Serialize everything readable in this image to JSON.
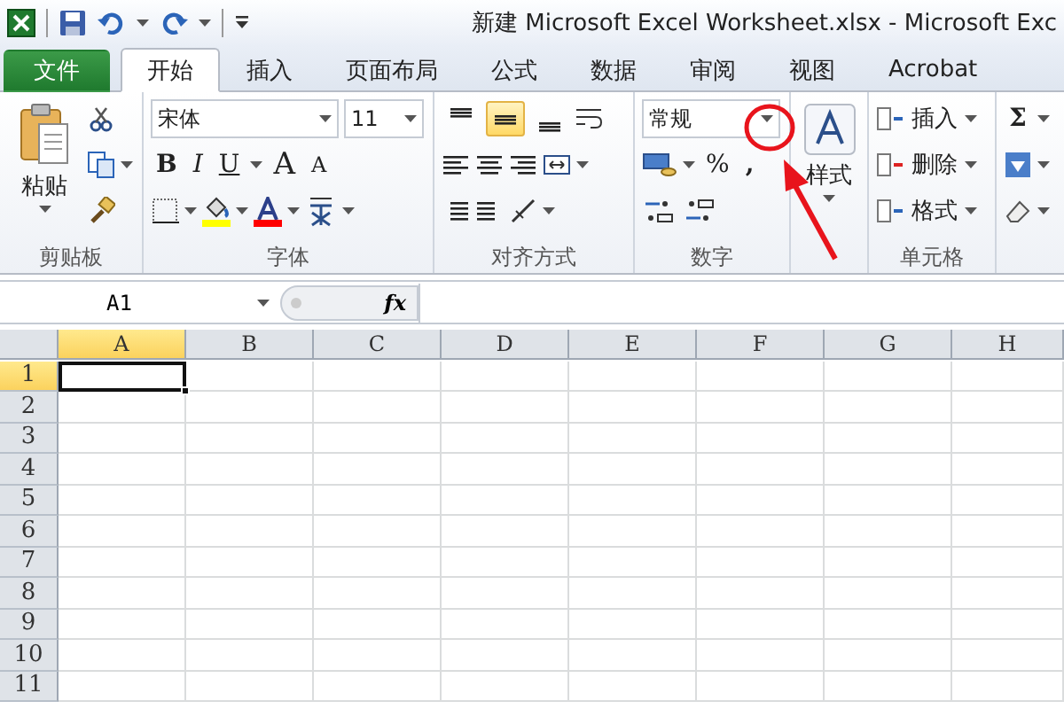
{
  "title_bar": {
    "title": "新建 Microsoft Excel Worksheet.xlsx  -  Microsoft Exc"
  },
  "tabs": [
    {
      "label": "文件",
      "kind": "file",
      "selected": false
    },
    {
      "label": "开始",
      "kind": "tab",
      "selected": true
    },
    {
      "label": "插入",
      "kind": "tab",
      "selected": false
    },
    {
      "label": "页面布局",
      "kind": "tab",
      "selected": false
    },
    {
      "label": "公式",
      "kind": "tab",
      "selected": false
    },
    {
      "label": "数据",
      "kind": "tab",
      "selected": false
    },
    {
      "label": "审阅",
      "kind": "tab",
      "selected": false
    },
    {
      "label": "视图",
      "kind": "tab",
      "selected": false
    },
    {
      "label": "Acrobat",
      "kind": "tab",
      "selected": false
    }
  ],
  "ribbon": {
    "clipboard": {
      "paste": "粘贴",
      "label": "剪贴板"
    },
    "font": {
      "name": "宋体",
      "size": "11",
      "bold": "B",
      "italic": "I",
      "underline": "U",
      "grow": "A",
      "shrink": "A",
      "label": "字体"
    },
    "alignment": {
      "vertical": [
        {
          "selected": false
        },
        {
          "selected": true
        },
        {
          "selected": false
        }
      ],
      "label": "对齐方式"
    },
    "number": {
      "format": "常规",
      "percent": "%",
      "comma": ",",
      "label": "数字"
    },
    "styles": {
      "button": "样式"
    },
    "cells": {
      "items": [
        "插入",
        "删除",
        "格式"
      ],
      "label": "单元格"
    },
    "editing": {
      "sum": "Σ"
    }
  },
  "formula_bar": {
    "name_box": "A1",
    "fx": "fx"
  },
  "sheet": {
    "columns": [
      {
        "label": "A",
        "selected": true
      },
      {
        "label": "B",
        "selected": false
      },
      {
        "label": "C",
        "selected": false
      },
      {
        "label": "D",
        "selected": false
      },
      {
        "label": "E",
        "selected": false
      },
      {
        "label": "F",
        "selected": false
      },
      {
        "label": "G",
        "selected": false
      },
      {
        "label": "H",
        "selected": false
      }
    ],
    "rows": [
      {
        "label": "1",
        "selected": true
      },
      {
        "label": "2",
        "selected": false
      },
      {
        "label": "3",
        "selected": false
      },
      {
        "label": "4",
        "selected": false
      },
      {
        "label": "5",
        "selected": false
      },
      {
        "label": "6",
        "selected": false
      },
      {
        "label": "7",
        "selected": false
      },
      {
        "label": "8",
        "selected": false
      },
      {
        "label": "9",
        "selected": false
      },
      {
        "label": "10",
        "selected": false
      },
      {
        "label": "11",
        "selected": false
      }
    ]
  }
}
